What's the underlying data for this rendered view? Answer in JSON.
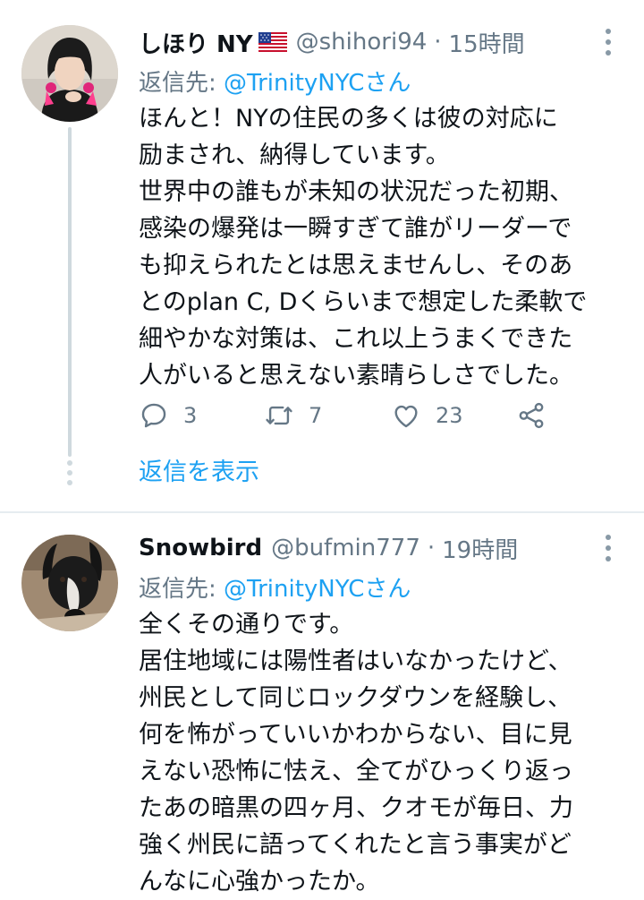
{
  "tweets": [
    {
      "display_name": "しほり NY",
      "handle": "@shihori94",
      "separator": "·",
      "time": "15時間",
      "reply_prefix": "返信先: ",
      "reply_mention": "@TrinityNYCさん",
      "text": "ほんと！NYの住民の多くは彼の対応に\n励まされ、納得しています。\n世界中の誰もが未知の状況だった初期、\n感染の爆発は一瞬すぎて誰がリーダーで\nも抑えられたとは思えませんし、そのあ\nとのplan C, Dくらいまで想定した柔軟で\n細やかな対策は、これ以上うまくできた\n人がいると思えない素晴らしさでした。",
      "replies": "3",
      "retweets": "7",
      "likes": "23",
      "show_replies": "返信を表示",
      "flag_icon": "us-flag-icon"
    },
    {
      "display_name": "Snowbird",
      "handle": "@bufmin777",
      "separator": "·",
      "time": "19時間",
      "reply_prefix": "返信先: ",
      "reply_mention": "@TrinityNYCさん",
      "text": "全くその通りです。\n居住地域には陽性者はいなかったけど、\n州民として同じロックダウンを経験し、\n何を怖がっていいかわからない、目に見\nえない恐怖に怯え、全てがひっくり返っ\nたあの暗黒の四ヶ月、クオモが毎日、力\n強く州民に語ってくれたと言う事実がど\nんなに心強かったか。"
    }
  ],
  "colors": {
    "text": "#0f1419",
    "secondary": "#657786",
    "accent": "#1da1f2",
    "divider": "#e6ecf0"
  }
}
